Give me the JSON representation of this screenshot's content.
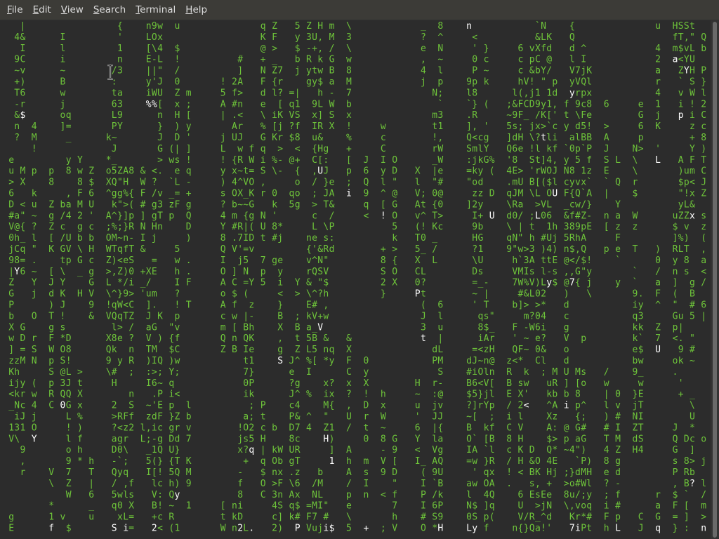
{
  "menubar": {
    "items": [
      {
        "label": "File",
        "mnemonic": "F",
        "rest": "ile"
      },
      {
        "label": "Edit",
        "mnemonic": "E",
        "rest": "dit"
      },
      {
        "label": "View",
        "mnemonic": "V",
        "rest": "iew"
      },
      {
        "label": "Search",
        "mnemonic": "S",
        "rest": "earch"
      },
      {
        "label": "Terminal",
        "mnemonic": "T",
        "rest": "erminal"
      },
      {
        "label": "Help",
        "mnemonic": "H",
        "rest": "elp"
      }
    ]
  },
  "terminal": {
    "colors": {
      "rain": "#6ec43a",
      "highlight": "#ffffff",
      "background": "#2c2c2c"
    },
    "rain_charset": "abcdefghijklmnopqrstuvwxyzABCDEFGHIJKLMNOPQRSTUVWXYZ0123456789!@#$%^&*()_+-=[]{};:'\",.<>/?\\|`~",
    "highlight_chars": [
      "U",
      "u",
      "S",
      "n",
      "x",
      "$",
      "I",
      "D",
      "a",
      "<",
      "P",
      "1",
      "+",
      "f",
      "8",
      "?",
      "0",
      "Z",
      "L",
      "y",
      "7",
      "%",
      "Y",
      "2",
      "l",
      "V",
      "i",
      "q",
      "t",
      "p",
      "H",
      "J",
      "j",
      "!",
      "k",
      "."
    ]
  }
}
